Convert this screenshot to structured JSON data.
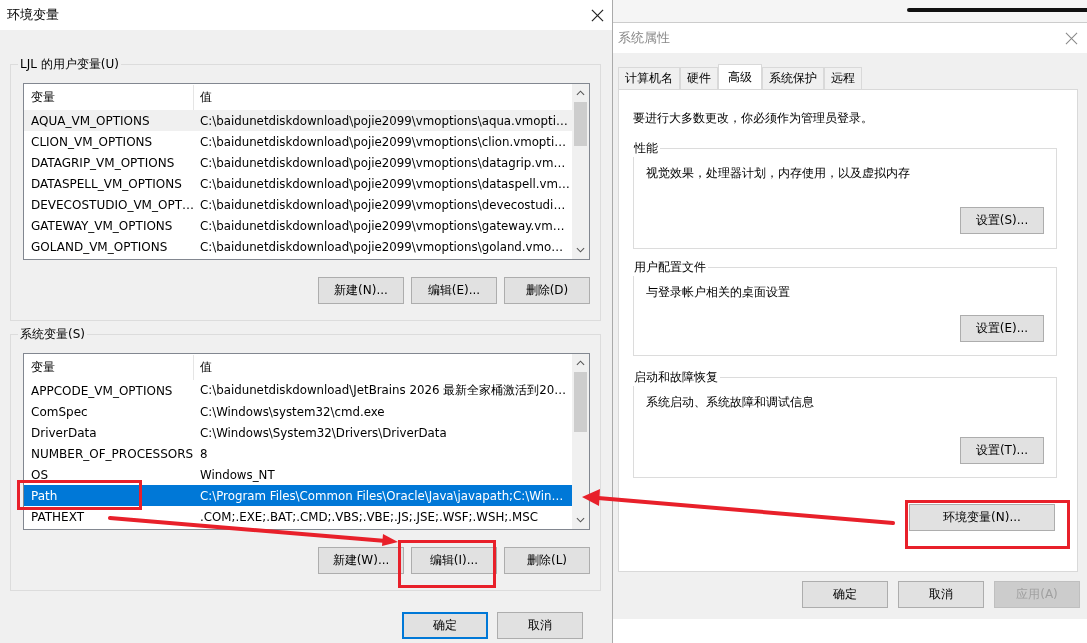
{
  "env_dialog": {
    "title": "环境变量",
    "user_group": {
      "label": "LJL 的用户变量(U)",
      "focused": false,
      "columns": [
        "变量",
        "值"
      ],
      "rows": [
        {
          "name": "AQUA_VM_OPTIONS",
          "value": "C:\\baidunetdiskdownload\\pojie2099\\vmoptions\\aqua.vmopti…",
          "selected": true
        },
        {
          "name": "CLION_VM_OPTIONS",
          "value": "C:\\baidunetdiskdownload\\pojie2099\\vmoptions\\clion.vmopti…",
          "selected": false
        },
        {
          "name": "DATAGRIP_VM_OPTIONS",
          "value": "C:\\baidunetdiskdownload\\pojie2099\\vmoptions\\datagrip.vm…",
          "selected": false
        },
        {
          "name": "DATASPELL_VM_OPTIONS",
          "value": "C:\\baidunetdiskdownload\\pojie2099\\vmoptions\\dataspell.vm…",
          "selected": false
        },
        {
          "name": "DEVECOSTUDIO_VM_OPT…",
          "value": "C:\\baidunetdiskdownload\\pojie2099\\vmoptions\\devecostudi…",
          "selected": false
        },
        {
          "name": "GATEWAY_VM_OPTIONS",
          "value": "C:\\baidunetdiskdownload\\pojie2099\\vmoptions\\gateway.vm…",
          "selected": false
        },
        {
          "name": "GOLAND_VM_OPTIONS",
          "value": "C:\\baidunetdiskdownload\\pojie2099\\vmoptions\\goland.vmo…",
          "selected": false
        }
      ],
      "buttons": [
        "新建(N)...",
        "编辑(E)...",
        "删除(D)"
      ]
    },
    "system_group": {
      "label": "系统变量(S)",
      "focused": true,
      "columns": [
        "变量",
        "值"
      ],
      "rows": [
        {
          "name": "APPCODE_VM_OPTIONS",
          "value": "C:\\baidunetdiskdownload\\JetBrains 2026 最新全家桶激活到20…",
          "selected": false
        },
        {
          "name": "ComSpec",
          "value": "C:\\Windows\\system32\\cmd.exe",
          "selected": false
        },
        {
          "name": "DriverData",
          "value": "C:\\Windows\\System32\\Drivers\\DriverData",
          "selected": false
        },
        {
          "name": "NUMBER_OF_PROCESSORS",
          "value": "8",
          "selected": false
        },
        {
          "name": "OS",
          "value": "Windows_NT",
          "selected": false
        },
        {
          "name": "Path",
          "value": "C:\\Program Files\\Common Files\\Oracle\\Java\\javapath;C:\\Win…",
          "selected": true
        },
        {
          "name": "PATHEXT",
          "value": ".COM;.EXE;.BAT;.CMD;.VBS;.VBE;.JS;.JSE;.WSF;.WSH;.MSC",
          "selected": false
        }
      ],
      "buttons": [
        "新建(W)...",
        "编辑(I)...",
        "删除(L)"
      ]
    },
    "footer_buttons": [
      {
        "label": "确定",
        "default": true
      },
      {
        "label": "取消",
        "default": false
      }
    ]
  },
  "sys_props": {
    "title": "系统属性",
    "tabs": [
      {
        "label": "计算机名",
        "selected": false
      },
      {
        "label": "硬件",
        "selected": false
      },
      {
        "label": "高级",
        "selected": true
      },
      {
        "label": "系统保护",
        "selected": false
      },
      {
        "label": "远程",
        "selected": false
      }
    ],
    "notice": "要进行大多数更改，你必须作为管理员登录。",
    "groups": [
      {
        "label": "性能",
        "description": "视觉效果，处理器计划，内存使用，以及虚拟内存",
        "button": "设置(S)..."
      },
      {
        "label": "用户配置文件",
        "description": "与登录帐户相关的桌面设置",
        "button": "设置(E)..."
      },
      {
        "label": "启动和故障恢复",
        "description": "系统启动、系统故障和调试信息",
        "button": "设置(T)..."
      }
    ],
    "env_button": "环境变量(N)...",
    "footer_buttons": [
      {
        "label": "确定",
        "disabled": false
      },
      {
        "label": "取消",
        "disabled": false
      },
      {
        "label": "应用(A)",
        "disabled": true
      }
    ]
  }
}
